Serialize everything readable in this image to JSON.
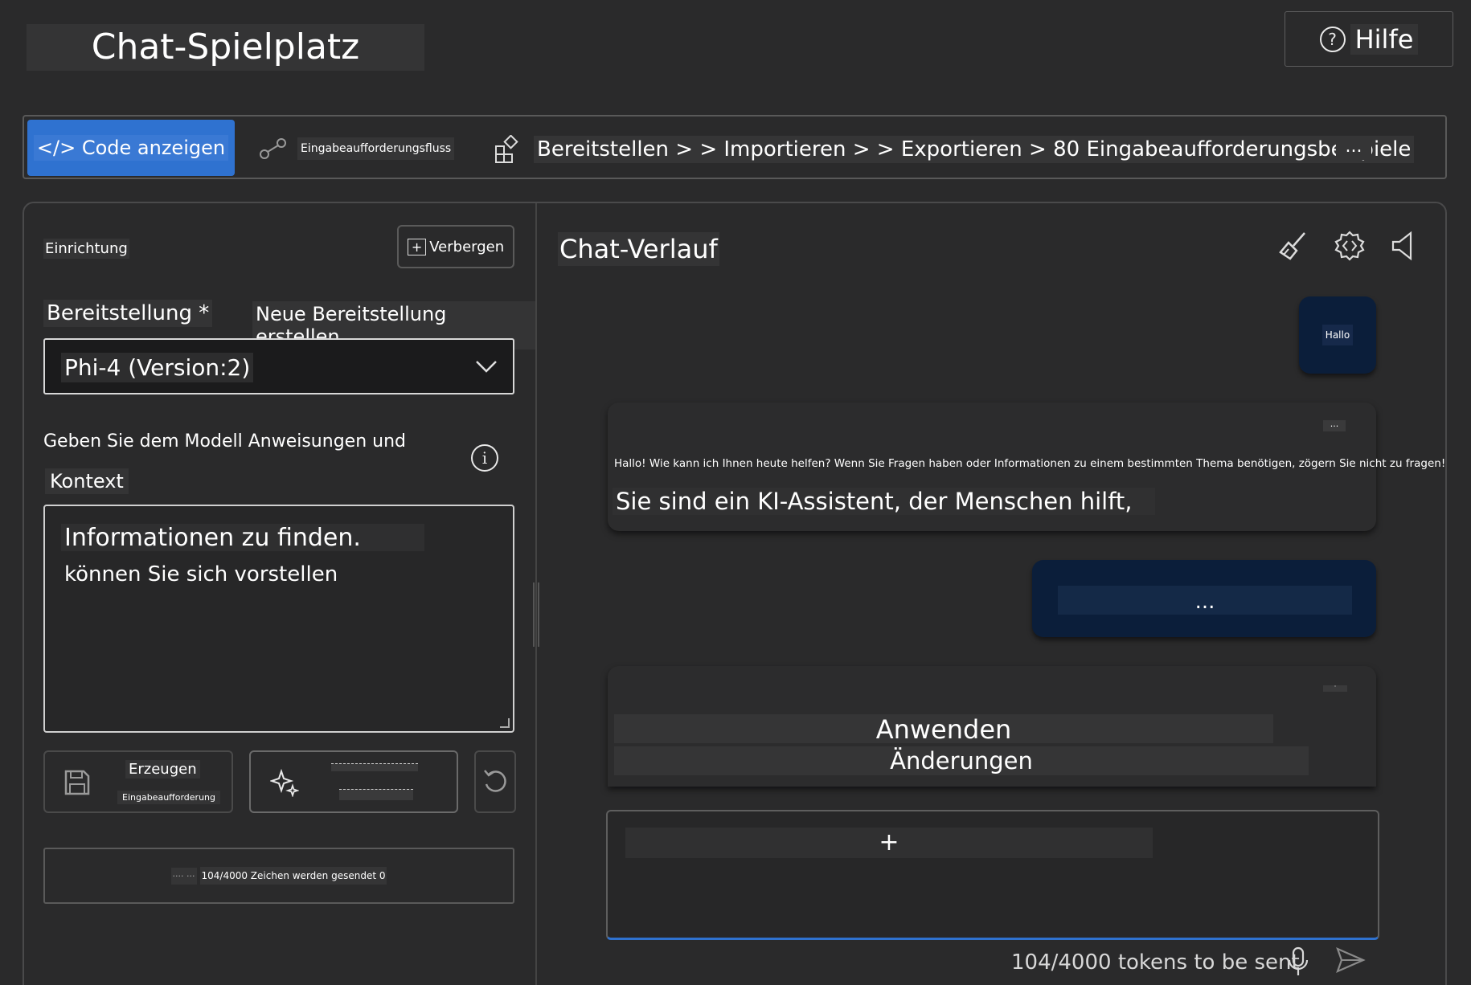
{
  "header": {
    "title": "Chat-Spielplatz",
    "help_label": "Hilfe",
    "help_icon": "?"
  },
  "toolbar": {
    "code_label": "</> Code anzeigen",
    "flow_label": "Eingabeaufforderungsfluss",
    "crumbs": "Bereitstellen > > Importieren > > Exportieren > 80 Eingabeaufforderungsbeispiele",
    "more": "..."
  },
  "setup": {
    "title": "Einrichtung",
    "hide_plus": "+",
    "hide_label": "Verbergen",
    "deployment_label": "Bereitstellung *",
    "new_deployment": "Neue Bereitstellung erstellen",
    "deployment_value": "Phi-4 (Version:2)",
    "instructions_line1": "Geben Sie dem Modell Anweisungen und",
    "instructions_line2": "Kontext",
    "info_icon": "i",
    "system_line1": "Informationen zu finden.",
    "system_line2": "können Sie sich vorstellen",
    "generate_label": "Erzeugen",
    "generate_sub": "Eingabeaufforderung",
    "char_count": "104/4000 Zeichen werden gesendet 0",
    "char_count_prefix": "···· ···"
  },
  "chat": {
    "title": "Chat-Verlauf",
    "messages": [
      {
        "role": "user",
        "text": "Hallo"
      },
      {
        "role": "assistant",
        "menu": "...",
        "line1": "Hallo! Wie kann ich Ihnen heute helfen? Wenn Sie Fragen haben oder Informationen zu einem bestimmten Thema benötigen, zögern Sie nicht zu fragen!",
        "line2": "Sie sind ein KI-Assistent, der Menschen hilft,"
      },
      {
        "role": "user",
        "text": "..."
      },
      {
        "role": "assistant",
        "menu": "·",
        "line1": "Anwenden",
        "line2": "Änderungen"
      }
    ],
    "input_plus": "+",
    "tokens": "104/4000 tokens to be sent"
  },
  "icons": {
    "broom": "broom-icon",
    "settings": "gear-icon",
    "speaker": "speaker-icon",
    "mic": "microphone-icon",
    "send": "send-icon",
    "save": "save-icon",
    "sparkle": "sparkle-icon",
    "undo": "undo-icon"
  },
  "colors": {
    "accent": "#2f72d0",
    "user_bubble": "#0b1e3a",
    "background": "#2a2a2b"
  }
}
